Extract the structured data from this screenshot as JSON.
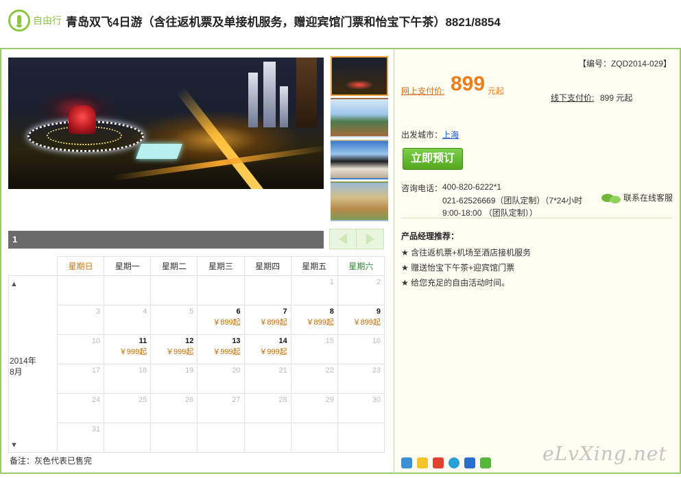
{
  "header": {
    "tag_label": "自由行",
    "title": "青岛双飞4日游（含往返机票及单接机服务，赠迎宾馆门票和怡宝下午茶）8821/8854"
  },
  "gallery": {
    "counter": "1"
  },
  "calendar": {
    "weekdays": [
      "星期日",
      "星期一",
      "星期二",
      "星期三",
      "星期四",
      "星期五",
      "星期六"
    ],
    "month_label": "2014年\n8月",
    "up_arrow": "▲",
    "down_arrow": "▼",
    "weeks": [
      [
        {
          "d": "",
          "p": ""
        },
        {
          "d": "",
          "p": ""
        },
        {
          "d": "",
          "p": ""
        },
        {
          "d": "",
          "p": ""
        },
        {
          "d": "",
          "p": ""
        },
        {
          "d": "1",
          "p": ""
        },
        {
          "d": "2",
          "p": ""
        }
      ],
      [
        {
          "d": "3",
          "p": ""
        },
        {
          "d": "4",
          "p": ""
        },
        {
          "d": "5",
          "p": ""
        },
        {
          "d": "6",
          "p": "￥899起"
        },
        {
          "d": "7",
          "p": "￥899起"
        },
        {
          "d": "8",
          "p": "￥899起"
        },
        {
          "d": "9",
          "p": "￥899起"
        }
      ],
      [
        {
          "d": "10",
          "p": ""
        },
        {
          "d": "11",
          "p": "￥999起"
        },
        {
          "d": "12",
          "p": "￥999起"
        },
        {
          "d": "13",
          "p": "￥999起"
        },
        {
          "d": "14",
          "p": "￥999起"
        },
        {
          "d": "15",
          "p": ""
        },
        {
          "d": "16",
          "p": ""
        }
      ],
      [
        {
          "d": "17",
          "p": ""
        },
        {
          "d": "18",
          "p": ""
        },
        {
          "d": "19",
          "p": ""
        },
        {
          "d": "20",
          "p": ""
        },
        {
          "d": "21",
          "p": ""
        },
        {
          "d": "22",
          "p": ""
        },
        {
          "d": "23",
          "p": ""
        }
      ],
      [
        {
          "d": "24",
          "p": ""
        },
        {
          "d": "25",
          "p": ""
        },
        {
          "d": "26",
          "p": ""
        },
        {
          "d": "27",
          "p": ""
        },
        {
          "d": "28",
          "p": ""
        },
        {
          "d": "29",
          "p": ""
        },
        {
          "d": "30",
          "p": ""
        }
      ],
      [
        {
          "d": "31",
          "p": ""
        },
        {
          "d": "",
          "p": ""
        },
        {
          "d": "",
          "p": ""
        },
        {
          "d": "",
          "p": ""
        },
        {
          "d": "",
          "p": ""
        },
        {
          "d": "",
          "p": ""
        },
        {
          "d": "",
          "p": ""
        }
      ]
    ],
    "note": "备注：灰色代表已售完"
  },
  "info": {
    "code": "【编号：ZQD2014-029】",
    "online_label": "网上支付价:",
    "online_price": "899",
    "online_unit": "元起",
    "offline_label": "线下支付价:",
    "offline_price": "899 元起",
    "city_label": "出发城市：",
    "city": "上海",
    "book_button": "立即预订",
    "phone_label": "咨询电话：",
    "phone_line1": "400-820-6222*1",
    "phone_line2": "021-62526669（团队定制）（7*24小时",
    "phone_line3": "9:00-18:00 （团队定制））",
    "chat_label": "联系在线客服",
    "rec_title": "产品经理推荐：",
    "rec_items": [
      "★ 含往返机票+机场至酒店接机服务",
      "★ 赠送怡宝下午茶+迎宾馆门票",
      "★ 给您充足的自由活动时间。"
    ]
  },
  "watermark": "eLvXing.net",
  "icons": {
    "tag": "recommend-badge-icon",
    "chat": "chat-bubbles-icon",
    "prev": "arrow-left-icon",
    "next": "arrow-right-icon",
    "share": [
      "share-plus-icon",
      "qzone-star-icon",
      "weibo-icon",
      "qq-icon",
      "renren-icon",
      "wechat-icon"
    ]
  },
  "colors": {
    "accent_green": "#8cc63f",
    "price_orange": "#f07c18",
    "link_blue": "#1a55c8",
    "frame_green": "#9ccc6a"
  }
}
